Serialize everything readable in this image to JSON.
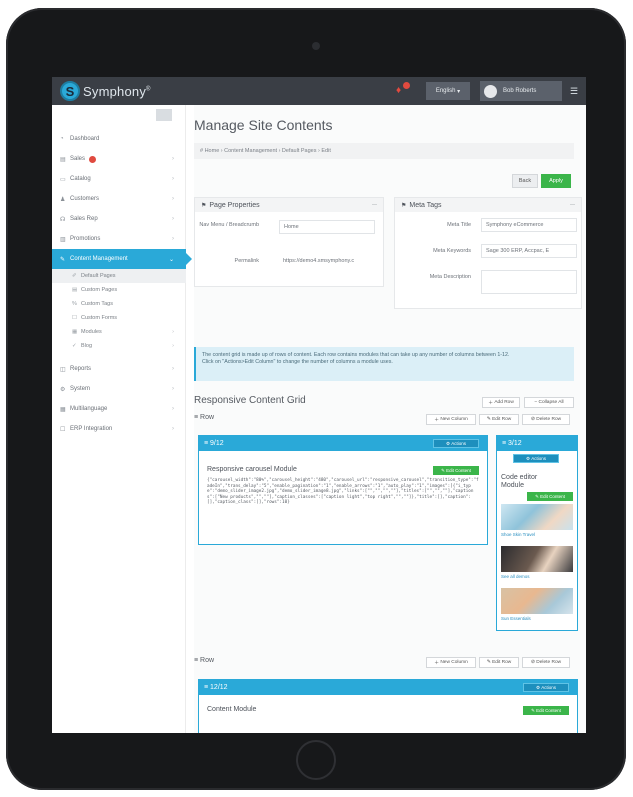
{
  "app": {
    "name": "Symphony",
    "logo_letter": "S"
  },
  "topbar": {
    "language": "English",
    "user_name": "Bob Roberts"
  },
  "sidebar": {
    "items": [
      {
        "label": "Dashboard",
        "icon": "dashboard-icon"
      },
      {
        "label": "Sales",
        "icon": "cart-icon",
        "badge": true
      },
      {
        "label": "Catalog",
        "icon": "tag-icon"
      },
      {
        "label": "Customers",
        "icon": "users-icon"
      },
      {
        "label": "Sales Rep",
        "icon": "rep-icon"
      },
      {
        "label": "Promotions",
        "icon": "promo-icon"
      },
      {
        "label": "Content Management",
        "icon": "pencil-icon",
        "active": true
      }
    ],
    "sub_items": [
      {
        "label": "Default Pages",
        "icon": "edit-icon",
        "selected": true
      },
      {
        "label": "Custom Pages",
        "icon": "pages-icon"
      },
      {
        "label": "Custom Tags",
        "icon": "tag-icon"
      },
      {
        "label": "Custom Forms",
        "icon": "form-icon"
      },
      {
        "label": "Modules",
        "icon": "module-icon"
      },
      {
        "label": "Blog",
        "icon": "blog-icon"
      }
    ],
    "items_bottom": [
      {
        "label": "Reports",
        "icon": "report-icon"
      },
      {
        "label": "System",
        "icon": "system-icon"
      },
      {
        "label": "Multilanguage",
        "icon": "globe-icon"
      },
      {
        "label": "ERP Integration",
        "icon": "erp-icon"
      }
    ]
  },
  "page": {
    "title": "Manage Site Contents",
    "breadcrumb": "# Home  ›  Content Management  ›  Default Pages  ›  Edit",
    "back_label": "Back",
    "apply_label": "Apply"
  },
  "page_properties": {
    "title": "Page Properties",
    "nav_label": "Nav Menu / Breadcrumb",
    "nav_value": "Home",
    "permalink_label": "Permalink",
    "permalink_value": "https://demo4.smsymphony.c"
  },
  "meta_tags": {
    "title": "Meta Tags",
    "title_label": "Meta Title",
    "title_value": "Symphony eCommerce",
    "keywords_label": "Meta Keywords",
    "keywords_value": "Sage 300 ERP, Accpac, E",
    "desc_label": "Meta Description",
    "desc_value": ""
  },
  "info": {
    "line1": "The content grid is made up of rows of content. Each row contains modules that can take up any number of columns between 1-12.",
    "line2": "Click on \"Actions>Edit Column\" to change the number of columns a module uses."
  },
  "grid": {
    "title": "Responsive Content Grid",
    "add_row": "Add Row",
    "collapse_all": "Collapse All",
    "row_label": "Row",
    "new_column": "New Column",
    "edit_row": "Edit Row",
    "delete_row": "Delete Row",
    "actions": "Actions",
    "edit_content": "Edit Content",
    "col1_title": "9/12",
    "col1_module": "Responsive carousel Module",
    "col1_code": "{\"carousel_width\":\"80%\",\"carousel_height\":\"480\",\"carousel_url\":\"responsive_carousel\",\"transition_type\":\"fadeIn\",\"trans_delay\":\"5\",\"enable_pagination\":\"1\",\"enable_arrows\":\"1\",\"auto_play\":\"1\",\"images\":[{\"i_type\":\"demo_slider_image2.jpg\",\"demo_slider_image8.jpg\",\"links\":[\"\",\"\",\"\",\"\"],\"titles\":[\"\",\"\",\"\"],\"captions\":[\"New products\",\"\",\"\"],\"caption_classes\":[\"caption light\",\"top right\",\"\",\"\"]},\"title\":[],\"caption\":[],\"caption_class\":[],\"rows\":10}",
    "col2_title": "3/12",
    "col2_module": "Code editor Module",
    "thumb1_caption": "Shoe Skin Travel",
    "thumb2_caption": "See all demos",
    "thumb3_caption": "Sun Essentials",
    "col3_title": "12/12",
    "col3_module": "Content Module"
  }
}
